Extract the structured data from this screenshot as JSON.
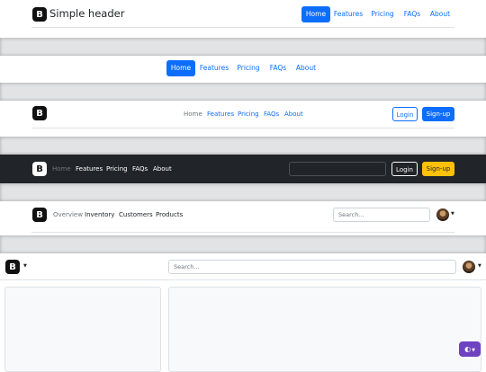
{
  "header1": {
    "title": "Simple header",
    "nav": [
      "Home",
      "Features",
      "Pricing",
      "FAQs",
      "About"
    ]
  },
  "header2": {
    "nav": [
      "Home",
      "Features",
      "Pricing",
      "FAQs",
      "About"
    ]
  },
  "header3": {
    "nav": [
      "Home",
      "Features",
      "Pricing",
      "FAQs",
      "About"
    ],
    "login_label": "Login",
    "signup_label": "Sign-up"
  },
  "header4": {
    "nav": [
      "Home",
      "Features",
      "Pricing",
      "FAQs",
      "About"
    ],
    "login_label": "Login",
    "signup_label": "Sign-up"
  },
  "header5": {
    "nav": [
      "Overview",
      "Inventory",
      "Customers",
      "Products"
    ],
    "search_placeholder": "Search..."
  },
  "header6": {
    "search_placeholder": "Search..."
  },
  "logo_letter": "B",
  "theme_toggle_icon": "◐",
  "colors": {
    "primary": "#0d6efd",
    "dark": "#212529",
    "warning": "#ffc107",
    "theme_button": "#6f42c1"
  }
}
